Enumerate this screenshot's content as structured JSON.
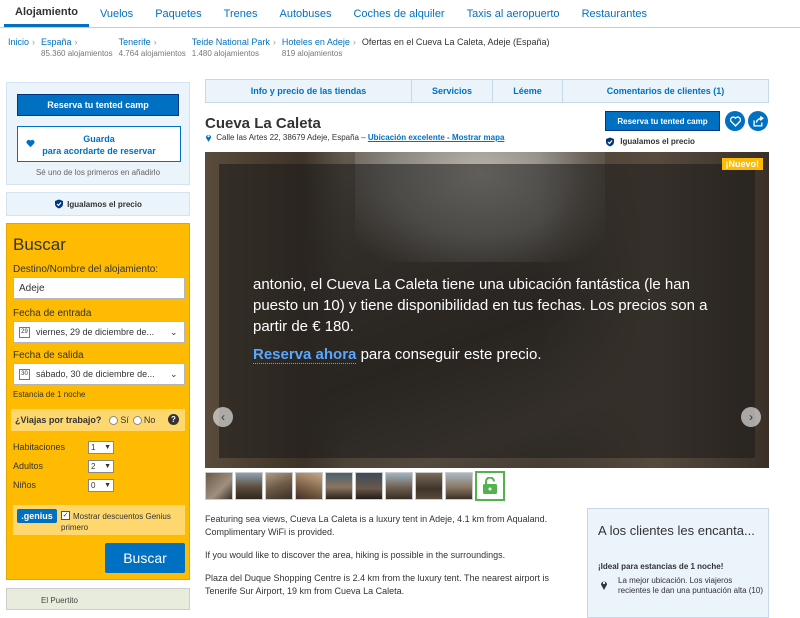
{
  "nav": {
    "tabs": [
      "Alojamiento",
      "Vuelos",
      "Paquetes",
      "Trenes",
      "Autobuses",
      "Coches de alquiler",
      "Taxis al aeropuerto",
      "Restaurantes"
    ],
    "active": "Alojamiento"
  },
  "breadcrumb": [
    {
      "label": "Inicio",
      "count": ""
    },
    {
      "label": "España",
      "count": "85.360 alojamientos"
    },
    {
      "label": "Tenerife",
      "count": "4.764 alojamientos"
    },
    {
      "label": "Teide National Park",
      "count": "1.480 alojamientos"
    },
    {
      "label": "Hoteles en Adeje",
      "count": "819 alojamientos"
    },
    {
      "label": "Ofertas en el Cueva La Caleta, Adeje (España)",
      "count": ""
    }
  ],
  "left": {
    "reserve_label": "Reserva tu tented camp",
    "save_label_1": "Guarda",
    "save_label_2": "para acordarte de reservar",
    "first_note": "Sé uno de los primeros en añadirlo",
    "price_match": "Igualamos el precio"
  },
  "search": {
    "title": "Buscar",
    "dest_label": "Destino/Nombre del alojamiento:",
    "dest_value": "Adeje",
    "checkin_label": "Fecha de entrada",
    "checkin_value": "viernes, 29 de diciembre de...",
    "checkin_day": "29",
    "checkout_label": "Fecha de salida",
    "checkout_value": "sábado, 30 de diciembre de...",
    "checkout_day": "30",
    "stay": "Estancia de 1 noche",
    "business_q": "¿Viajas por trabajo?",
    "yes": "Sí",
    "no": "No",
    "rooms_label": "Habitaciones",
    "rooms_value": "1",
    "adults_label": "Adultos",
    "adults_value": "2",
    "kids_label": "Niños",
    "kids_value": "0",
    "genius_logo": ".genius",
    "genius_text": "Mostrar descuentos Genius primero",
    "button": "Buscar"
  },
  "map_label": "El Puertito",
  "tabs": [
    "Info y precio de las tiendas",
    "Servicios",
    "Léeme",
    "Comentarios de clientes (1)"
  ],
  "hotel": {
    "name": "Cueva La Caleta",
    "address": "Calle las Artes 22, 38679 Adeje, España –",
    "map_link": "Ubicación excelente - Mostrar mapa",
    "reserve_btn": "Reserva tu tented camp",
    "price_match": "Igualamos el precio"
  },
  "photo": {
    "badge": "¡Nuevo!",
    "message": "antonio, el Cueva La Caleta tiene una ubicación fantástica (le han puesto un 10) y tiene disponibilidad en tus fechas. Los precios son a partir de € 180.",
    "cta_link": "Reserva ahora",
    "cta_rest": " para conseguir este precio."
  },
  "description": [
    "Featuring sea views, Cueva La Caleta is a luxury tent in Adeje, 4.1 km from Aqualand. Complimentary WiFi is provided.",
    "If you would like to discover the area, hiking is possible in the surroundings.",
    "Plaza del Duque Shopping Centre is 2.4 km from the luxury tent. The nearest airport is Tenerife Sur Airport, 19 km from Cueva La Caleta."
  ],
  "praise": {
    "title": "A los clientes les encanta...",
    "ideal": "¡Ideal para estancias de 1 noche!",
    "best": "La mejor ubicación. Los viajeros recientes le dan una puntuación alta (10)"
  },
  "colors": {
    "brand": "#0071c2",
    "search_bg": "#febb02",
    "pale_blue": "#ebf3fb"
  }
}
